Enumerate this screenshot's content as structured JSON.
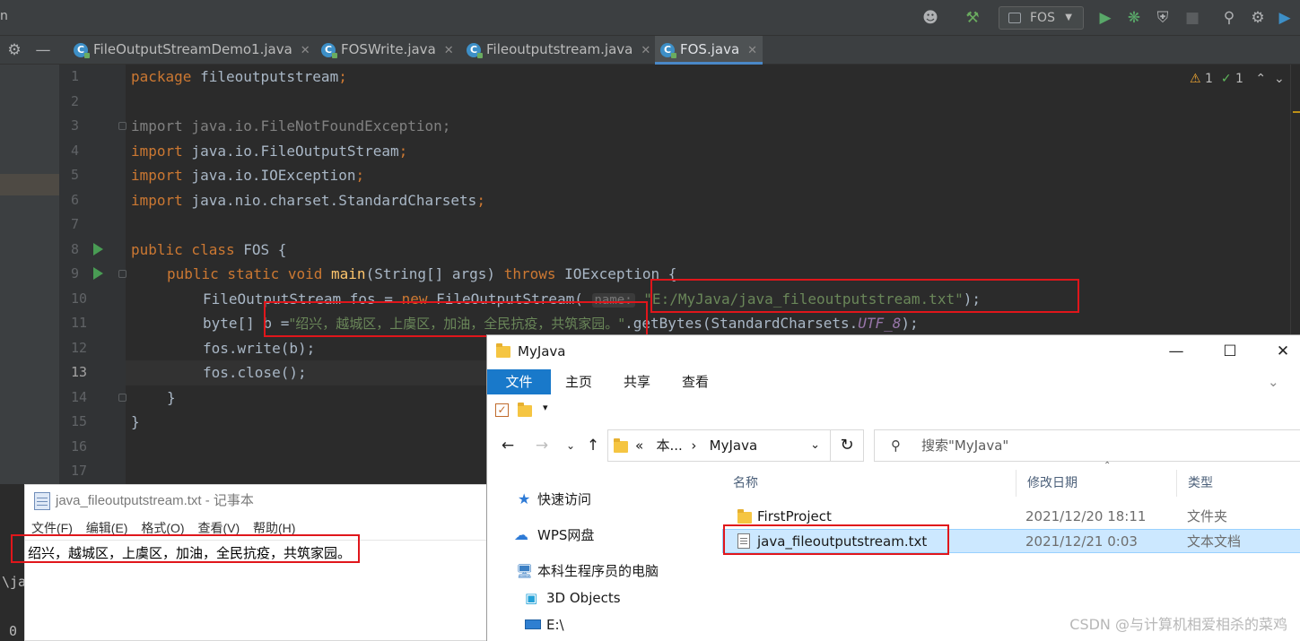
{
  "ide": {
    "menu_fragment": "n",
    "run_config": "FOS",
    "tabs": [
      {
        "label": "FileOutputStreamDemo1.java",
        "active": false
      },
      {
        "label": "FOSWrite.java",
        "active": false
      },
      {
        "label": "Fileoutputstream.java",
        "active": false
      },
      {
        "label": "FOS.java",
        "active": true
      }
    ],
    "inspection": {
      "warnings": "1",
      "ok": "1"
    },
    "current_line": 13,
    "line_numbers": [
      "1",
      "2",
      "3",
      "4",
      "5",
      "6",
      "7",
      "8",
      "9",
      "10",
      "11",
      "12",
      "13",
      "14",
      "15",
      "16",
      "17"
    ],
    "code": {
      "l1_kw": "package",
      "l1_rest": " fileoutputstream",
      "semi": ";",
      "l3_kw": "import",
      "l3_rest": " java.io.FileNotFoundException;",
      "l4_rest": " java.io.FileOutputStream",
      "l5_rest": " java.io.IOException",
      "l6_rest": " java.nio.charset.StandardCharsets",
      "l8_kw": "public class",
      "l8_rest": " FOS {",
      "l9_kw1": "public static void",
      "l9_fn": "main",
      "l9_mid": "(String[] args) ",
      "l9_kw2": "throws",
      "l9_end": " IOException {",
      "l10_a": "FileOutputStream fos = ",
      "l10_kw": "new",
      "l10_b": " FileOutputStream(",
      "l10_hint": "name:",
      "l10_str": "\"E:/MyJava/java_fileoutputstream.txt\"",
      "l10_end": ");",
      "l11_a": "byte[] b =",
      "l11_str": "\"绍兴，越城区，上虞区，加油，全民抗疫，共筑家园。\"",
      "l11_b": ".getBytes(StandardCharsets.",
      "l11_const": "UTF_8",
      "l11_end": ");",
      "l12": "fos.write(b);",
      "l13": "fos.close();",
      "l14": "}",
      "l15": "}"
    }
  },
  "console": {
    "line1": "\\ja",
    "line2": "0"
  },
  "notepad": {
    "title": "java_fileoutputstream.txt - 记事本",
    "menu": [
      "文件(F)",
      "编辑(E)",
      "格式(O)",
      "查看(V)",
      "帮助(H)"
    ],
    "content": "绍兴，越城区，上虞区，加油，全民抗疫，共筑家园。"
  },
  "explorer": {
    "title": "MyJava",
    "ribbon_tabs": [
      "文件",
      "主页",
      "共享",
      "查看"
    ],
    "address_prefix": "«",
    "address_parts": [
      "本...",
      "MyJava"
    ],
    "search_placeholder": "搜索\"MyJava\"",
    "nav": [
      "快速访问",
      "WPS网盘",
      "本科生程序员的电脑",
      "3D Objects",
      "E:\\"
    ],
    "columns": [
      "名称",
      "修改日期",
      "类型"
    ],
    "rows": [
      {
        "name": "FirstProject",
        "date": "2021/12/20 18:11",
        "type": "文件夹"
      },
      {
        "name": "java_fileoutputstream.txt",
        "date": "2021/12/21 0:03",
        "type": "文本文档"
      }
    ]
  },
  "watermark": "CSDN @与计算机相爱相杀的菜鸡",
  "colors": {
    "highlight_box": "#e0161b",
    "accent": "#1979ca",
    "keyword": "#cc7832",
    "string": "#6a8759"
  }
}
